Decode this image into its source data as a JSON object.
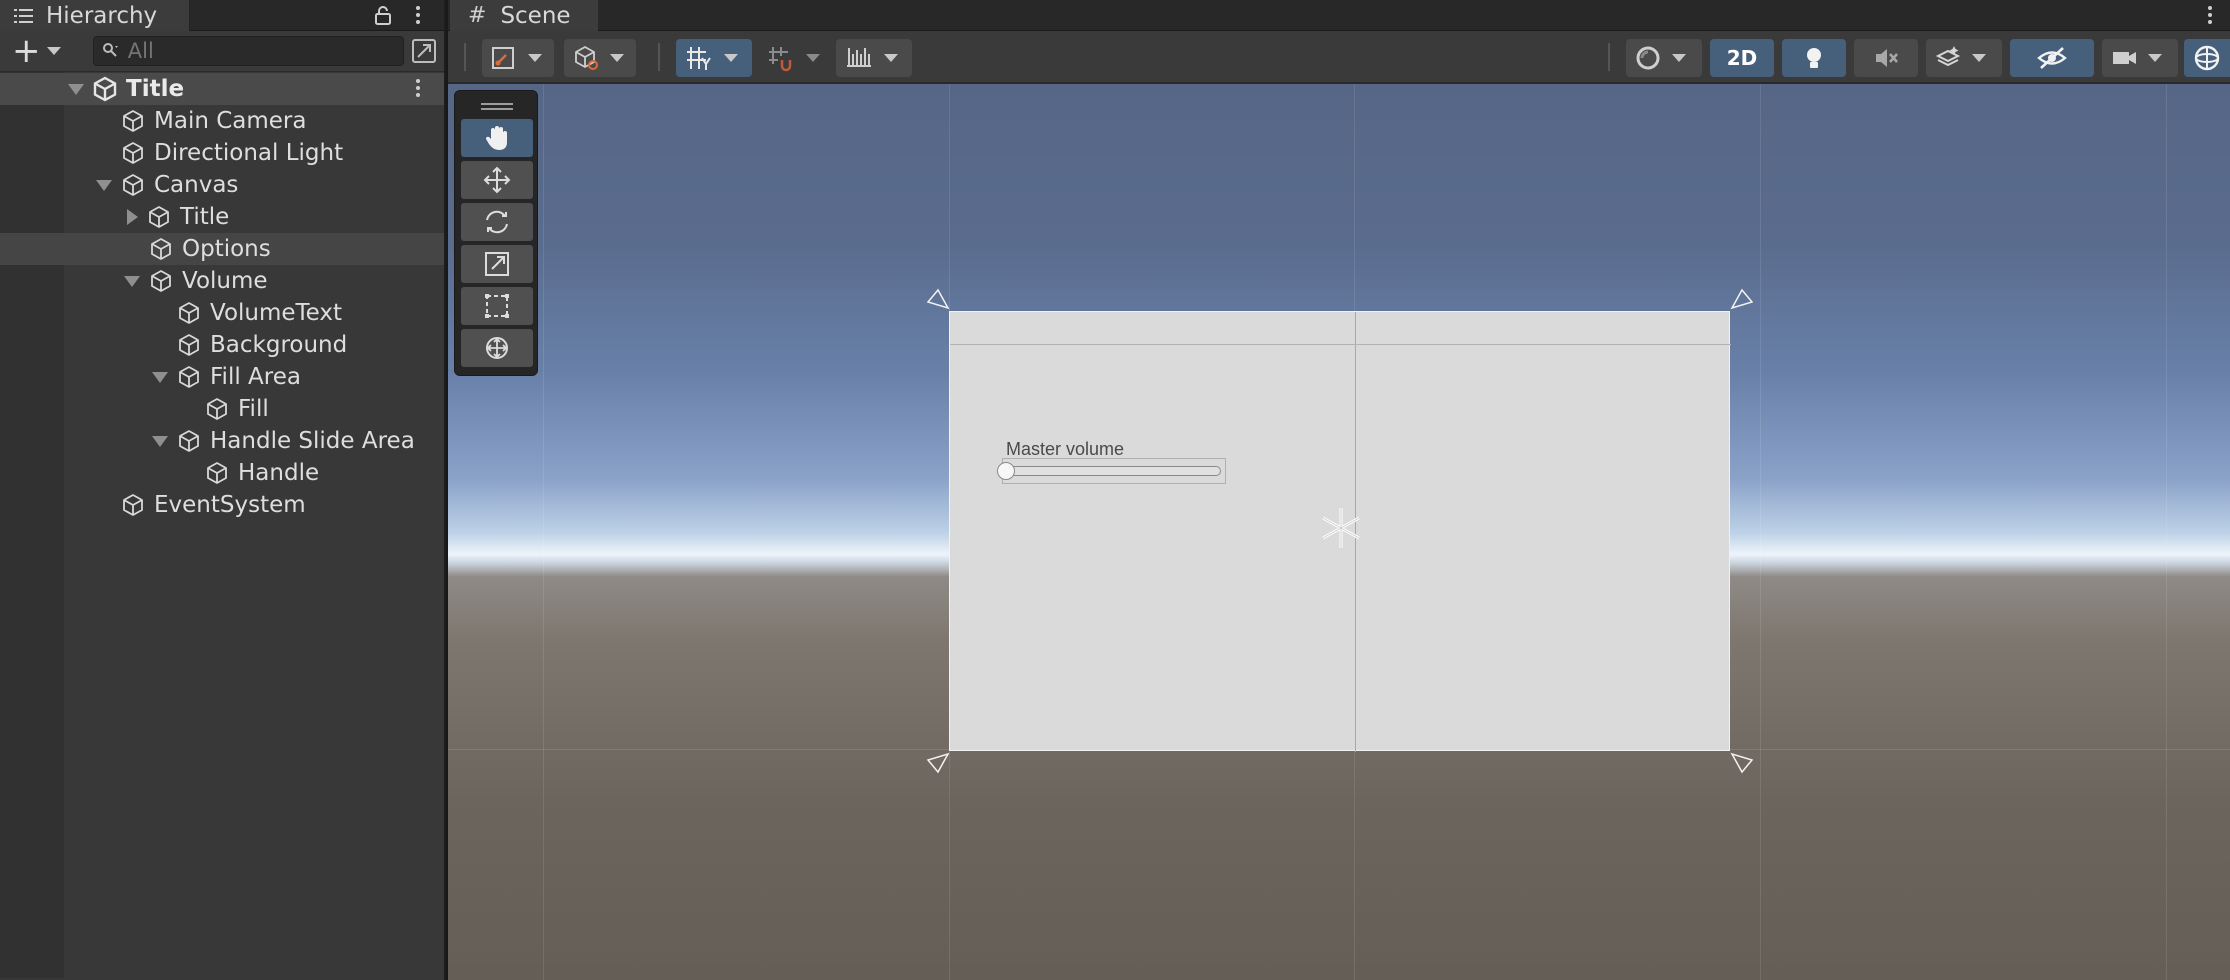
{
  "hierarchy": {
    "tab_label": "Hierarchy",
    "search_placeholder": "All",
    "scene_name": "Title",
    "items": [
      {
        "label": "Main Camera"
      },
      {
        "label": "Directional Light"
      },
      {
        "label": "Canvas"
      },
      {
        "label": "Title"
      },
      {
        "label": "Options"
      },
      {
        "label": "Volume"
      },
      {
        "label": "VolumeText"
      },
      {
        "label": "Background"
      },
      {
        "label": "Fill Area"
      },
      {
        "label": "Fill"
      },
      {
        "label": "Handle Slide Area"
      },
      {
        "label": "Handle"
      },
      {
        "label": "EventSystem"
      }
    ]
  },
  "scene": {
    "tab_label": "Scene",
    "toolbar": {
      "mode_2d_label": "2D"
    },
    "canvas": {
      "volume_label": "Master volume",
      "slider_value": 0.0
    },
    "tools": [
      "hand",
      "move",
      "rotate",
      "scale",
      "rect",
      "transform"
    ]
  },
  "colors": {
    "panel_bg": "#383838",
    "accent": "#46607c",
    "canvas_bg": "#dadada"
  }
}
